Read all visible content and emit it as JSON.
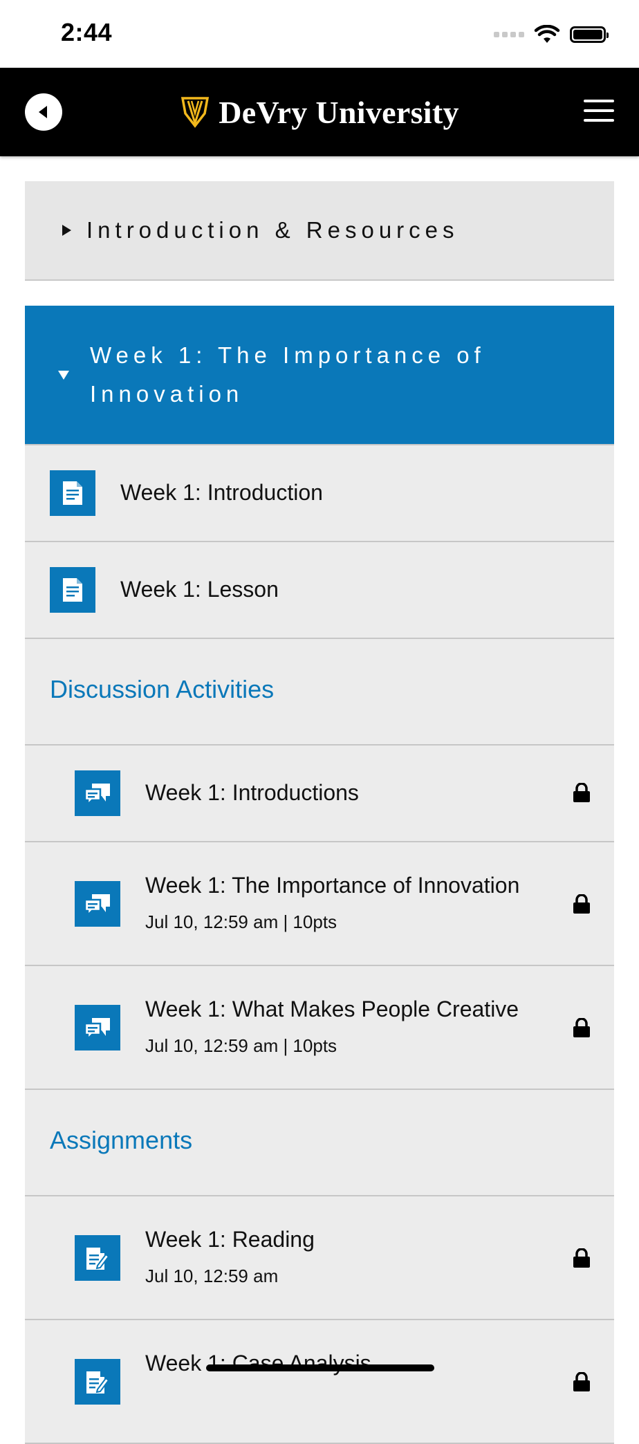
{
  "status_bar": {
    "time": "2:44"
  },
  "header": {
    "brand": "DeVry University"
  },
  "sections": [
    {
      "title": "Introduction & Resources",
      "expanded": false
    },
    {
      "title": "Week 1: The Importance of Innovation",
      "expanded": true
    }
  ],
  "items": {
    "intro": {
      "title": "Week 1: Introduction",
      "icon": "document-icon"
    },
    "lesson": {
      "title": "Week 1: Lesson",
      "icon": "document-icon"
    }
  },
  "discussion": {
    "heading": "Discussion Activities",
    "items": [
      {
        "title": "Week 1: Introductions",
        "sub": "",
        "icon": "discussion-icon",
        "locked": true
      },
      {
        "title": "Week 1: The Importance of Innovation",
        "sub": "Jul 10, 12:59 am | 10pts",
        "icon": "discussion-icon",
        "locked": true
      },
      {
        "title": "Week 1: What Makes People Creative",
        "sub": "Jul 10, 12:59 am | 10pts",
        "icon": "discussion-icon",
        "locked": true
      }
    ]
  },
  "assignments": {
    "heading": "Assignments",
    "items": [
      {
        "title": "Week 1: Reading",
        "sub": "Jul 10, 12:59 am",
        "icon": "assignment-icon",
        "locked": true
      },
      {
        "title": "Week 1: Case Analysis",
        "sub": "",
        "icon": "assignment-icon",
        "locked": true
      }
    ]
  },
  "colors": {
    "accent": "#0a78b9",
    "header_bg": "#000000",
    "row_bg": "#ececec"
  }
}
